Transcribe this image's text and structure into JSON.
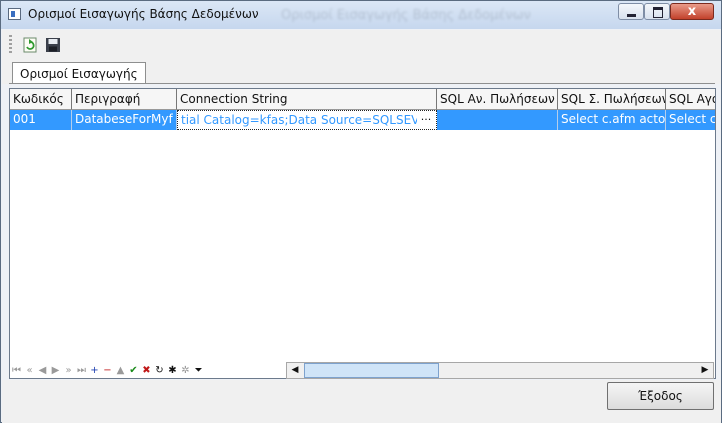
{
  "window": {
    "title": "Ορισμοί Εισαγωγής Βάσης Δεδομένων",
    "blurred_title": "Ορισμοί Εισαγωγής Βάσης Δεδομένων",
    "close_glyph": "x"
  },
  "toolbar": {
    "buttons": [
      "refresh-icon",
      "save-icon"
    ]
  },
  "tabs": [
    {
      "label": "Ορισμοί Εισαγωγής",
      "active": true
    }
  ],
  "grid": {
    "columns": [
      "Κωδικός",
      "Περιγραφή",
      "Connection String",
      "SQL Αν. Πωλήσεων",
      "SQL Σ. Πωλήσεων",
      "SQL Αγο"
    ],
    "rows": [
      [
        "001",
        "DatabeseForMyf",
        "tial Catalog=kfas;Data Source=SQLSEVER",
        "",
        "Select c.afm actor",
        "Select c"
      ]
    ],
    "selected_row": 0,
    "editing_cell": "Connection String",
    "ellipsis": "···"
  },
  "navigator": {
    "buttons": [
      {
        "icon": "first-icon",
        "glyph": "⏮"
      },
      {
        "icon": "prev-page-icon",
        "glyph": "«"
      },
      {
        "icon": "prev-icon",
        "glyph": "◀"
      },
      {
        "icon": "next-icon",
        "glyph": "▶"
      },
      {
        "icon": "next-page-icon",
        "glyph": "»"
      },
      {
        "icon": "last-icon",
        "glyph": "⏭"
      },
      {
        "icon": "add-icon",
        "glyph": "+"
      },
      {
        "icon": "delete-icon",
        "glyph": "−"
      },
      {
        "icon": "edit-icon",
        "glyph": "▲"
      },
      {
        "icon": "post-icon",
        "glyph": "✔"
      },
      {
        "icon": "cancel-icon",
        "glyph": "✖"
      },
      {
        "icon": "refresh-icon",
        "glyph": "↻"
      },
      {
        "icon": "bookmark-icon",
        "glyph": "✱"
      },
      {
        "icon": "goto-bookmark-icon",
        "glyph": "✲"
      },
      {
        "icon": "filter-icon",
        "glyph": "⏷"
      }
    ],
    "colors": {
      "add": "#1c3fb0",
      "delete": "#c01818",
      "post": "#1a8a1a",
      "cancel": "#c01818",
      "disabled": "#9a9a9a",
      "default": "#111111"
    }
  },
  "buttons": {
    "exit_label": "Έξοδος"
  },
  "colors": {
    "selection": "#3399ff",
    "titlebar": "#c6d7ee"
  }
}
